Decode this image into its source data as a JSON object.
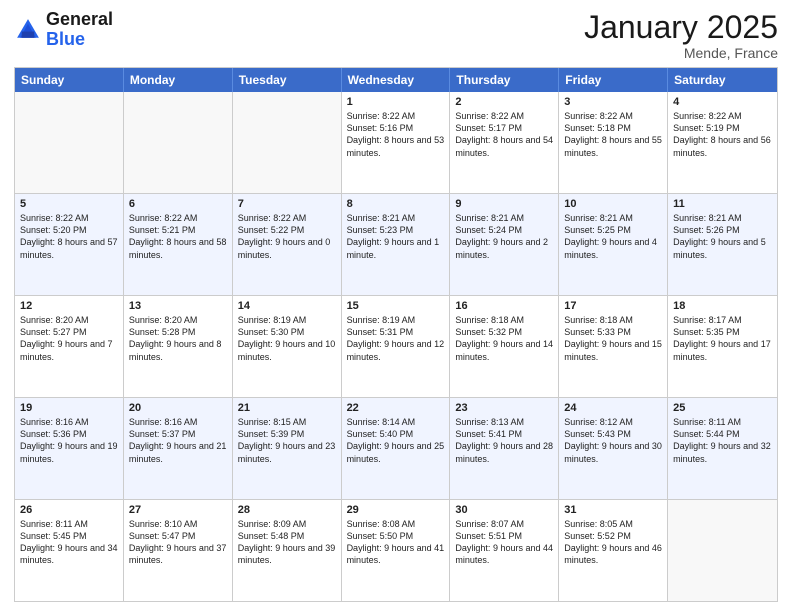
{
  "logo": {
    "line1": "General",
    "line2": "Blue"
  },
  "title": "January 2025",
  "location": "Mende, France",
  "days": [
    "Sunday",
    "Monday",
    "Tuesday",
    "Wednesday",
    "Thursday",
    "Friday",
    "Saturday"
  ],
  "rows": [
    [
      {
        "day": "",
        "sunrise": "",
        "sunset": "",
        "daylight": "",
        "alt": false
      },
      {
        "day": "",
        "sunrise": "",
        "sunset": "",
        "daylight": "",
        "alt": false
      },
      {
        "day": "",
        "sunrise": "",
        "sunset": "",
        "daylight": "",
        "alt": false
      },
      {
        "day": "1",
        "sunrise": "Sunrise: 8:22 AM",
        "sunset": "Sunset: 5:16 PM",
        "daylight": "Daylight: 8 hours and 53 minutes.",
        "alt": false
      },
      {
        "day": "2",
        "sunrise": "Sunrise: 8:22 AM",
        "sunset": "Sunset: 5:17 PM",
        "daylight": "Daylight: 8 hours and 54 minutes.",
        "alt": false
      },
      {
        "day": "3",
        "sunrise": "Sunrise: 8:22 AM",
        "sunset": "Sunset: 5:18 PM",
        "daylight": "Daylight: 8 hours and 55 minutes.",
        "alt": false
      },
      {
        "day": "4",
        "sunrise": "Sunrise: 8:22 AM",
        "sunset": "Sunset: 5:19 PM",
        "daylight": "Daylight: 8 hours and 56 minutes.",
        "alt": false
      }
    ],
    [
      {
        "day": "5",
        "sunrise": "Sunrise: 8:22 AM",
        "sunset": "Sunset: 5:20 PM",
        "daylight": "Daylight: 8 hours and 57 minutes.",
        "alt": true
      },
      {
        "day": "6",
        "sunrise": "Sunrise: 8:22 AM",
        "sunset": "Sunset: 5:21 PM",
        "daylight": "Daylight: 8 hours and 58 minutes.",
        "alt": true
      },
      {
        "day": "7",
        "sunrise": "Sunrise: 8:22 AM",
        "sunset": "Sunset: 5:22 PM",
        "daylight": "Daylight: 9 hours and 0 minutes.",
        "alt": true
      },
      {
        "day": "8",
        "sunrise": "Sunrise: 8:21 AM",
        "sunset": "Sunset: 5:23 PM",
        "daylight": "Daylight: 9 hours and 1 minute.",
        "alt": true
      },
      {
        "day": "9",
        "sunrise": "Sunrise: 8:21 AM",
        "sunset": "Sunset: 5:24 PM",
        "daylight": "Daylight: 9 hours and 2 minutes.",
        "alt": true
      },
      {
        "day": "10",
        "sunrise": "Sunrise: 8:21 AM",
        "sunset": "Sunset: 5:25 PM",
        "daylight": "Daylight: 9 hours and 4 minutes.",
        "alt": true
      },
      {
        "day": "11",
        "sunrise": "Sunrise: 8:21 AM",
        "sunset": "Sunset: 5:26 PM",
        "daylight": "Daylight: 9 hours and 5 minutes.",
        "alt": true
      }
    ],
    [
      {
        "day": "12",
        "sunrise": "Sunrise: 8:20 AM",
        "sunset": "Sunset: 5:27 PM",
        "daylight": "Daylight: 9 hours and 7 minutes.",
        "alt": false
      },
      {
        "day": "13",
        "sunrise": "Sunrise: 8:20 AM",
        "sunset": "Sunset: 5:28 PM",
        "daylight": "Daylight: 9 hours and 8 minutes.",
        "alt": false
      },
      {
        "day": "14",
        "sunrise": "Sunrise: 8:19 AM",
        "sunset": "Sunset: 5:30 PM",
        "daylight": "Daylight: 9 hours and 10 minutes.",
        "alt": false
      },
      {
        "day": "15",
        "sunrise": "Sunrise: 8:19 AM",
        "sunset": "Sunset: 5:31 PM",
        "daylight": "Daylight: 9 hours and 12 minutes.",
        "alt": false
      },
      {
        "day": "16",
        "sunrise": "Sunrise: 8:18 AM",
        "sunset": "Sunset: 5:32 PM",
        "daylight": "Daylight: 9 hours and 14 minutes.",
        "alt": false
      },
      {
        "day": "17",
        "sunrise": "Sunrise: 8:18 AM",
        "sunset": "Sunset: 5:33 PM",
        "daylight": "Daylight: 9 hours and 15 minutes.",
        "alt": false
      },
      {
        "day": "18",
        "sunrise": "Sunrise: 8:17 AM",
        "sunset": "Sunset: 5:35 PM",
        "daylight": "Daylight: 9 hours and 17 minutes.",
        "alt": false
      }
    ],
    [
      {
        "day": "19",
        "sunrise": "Sunrise: 8:16 AM",
        "sunset": "Sunset: 5:36 PM",
        "daylight": "Daylight: 9 hours and 19 minutes.",
        "alt": true
      },
      {
        "day": "20",
        "sunrise": "Sunrise: 8:16 AM",
        "sunset": "Sunset: 5:37 PM",
        "daylight": "Daylight: 9 hours and 21 minutes.",
        "alt": true
      },
      {
        "day": "21",
        "sunrise": "Sunrise: 8:15 AM",
        "sunset": "Sunset: 5:39 PM",
        "daylight": "Daylight: 9 hours and 23 minutes.",
        "alt": true
      },
      {
        "day": "22",
        "sunrise": "Sunrise: 8:14 AM",
        "sunset": "Sunset: 5:40 PM",
        "daylight": "Daylight: 9 hours and 25 minutes.",
        "alt": true
      },
      {
        "day": "23",
        "sunrise": "Sunrise: 8:13 AM",
        "sunset": "Sunset: 5:41 PM",
        "daylight": "Daylight: 9 hours and 28 minutes.",
        "alt": true
      },
      {
        "day": "24",
        "sunrise": "Sunrise: 8:12 AM",
        "sunset": "Sunset: 5:43 PM",
        "daylight": "Daylight: 9 hours and 30 minutes.",
        "alt": true
      },
      {
        "day": "25",
        "sunrise": "Sunrise: 8:11 AM",
        "sunset": "Sunset: 5:44 PM",
        "daylight": "Daylight: 9 hours and 32 minutes.",
        "alt": true
      }
    ],
    [
      {
        "day": "26",
        "sunrise": "Sunrise: 8:11 AM",
        "sunset": "Sunset: 5:45 PM",
        "daylight": "Daylight: 9 hours and 34 minutes.",
        "alt": false
      },
      {
        "day": "27",
        "sunrise": "Sunrise: 8:10 AM",
        "sunset": "Sunset: 5:47 PM",
        "daylight": "Daylight: 9 hours and 37 minutes.",
        "alt": false
      },
      {
        "day": "28",
        "sunrise": "Sunrise: 8:09 AM",
        "sunset": "Sunset: 5:48 PM",
        "daylight": "Daylight: 9 hours and 39 minutes.",
        "alt": false
      },
      {
        "day": "29",
        "sunrise": "Sunrise: 8:08 AM",
        "sunset": "Sunset: 5:50 PM",
        "daylight": "Daylight: 9 hours and 41 minutes.",
        "alt": false
      },
      {
        "day": "30",
        "sunrise": "Sunrise: 8:07 AM",
        "sunset": "Sunset: 5:51 PM",
        "daylight": "Daylight: 9 hours and 44 minutes.",
        "alt": false
      },
      {
        "day": "31",
        "sunrise": "Sunrise: 8:05 AM",
        "sunset": "Sunset: 5:52 PM",
        "daylight": "Daylight: 9 hours and 46 minutes.",
        "alt": false
      },
      {
        "day": "",
        "sunrise": "",
        "sunset": "",
        "daylight": "",
        "alt": false
      }
    ]
  ]
}
